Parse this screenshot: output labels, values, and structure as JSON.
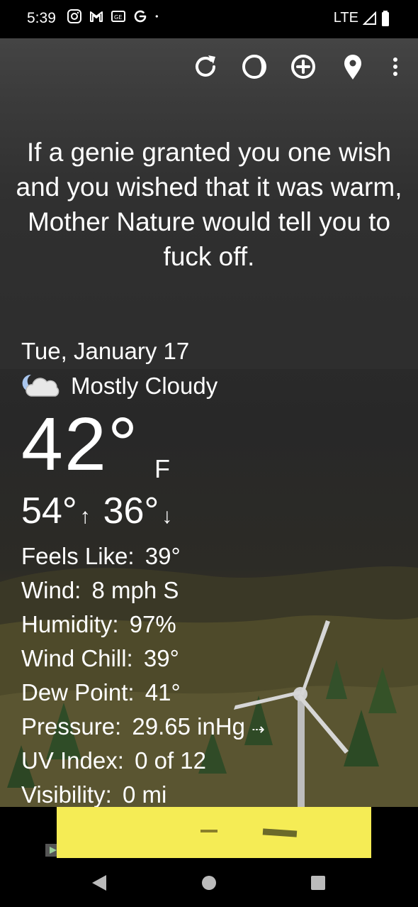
{
  "status_bar": {
    "time": "5:39",
    "network": "LTE",
    "notification_icons": [
      "instagram-icon",
      "gmail-icon",
      "news-icon",
      "google-icon",
      "dot-icon"
    ]
  },
  "toolbar": {
    "icons": [
      "refresh-icon",
      "theme-icon",
      "add-location-icon",
      "location-pin-icon",
      "more-options-icon"
    ]
  },
  "quote": "If a genie granted you one wish and you wished that it was warm, Mother Nature would tell you to fuck off.",
  "weather": {
    "date": "Tue, January 17",
    "condition": "Mostly Cloudy",
    "condition_icon": "moon-cloud-icon",
    "temperature": "42",
    "degree_symbol": "°",
    "unit": "F",
    "high": "54°",
    "high_arrow": "↑",
    "low": "36°",
    "low_arrow": "↓"
  },
  "details": {
    "feels_like_label": "Feels Like:",
    "feels_like_value": "39°",
    "wind_label": "Wind:",
    "wind_value": "8 mph S",
    "humidity_label": "Humidity:",
    "humidity_value": "97%",
    "wind_chill_label": "Wind Chill:",
    "wind_chill_value": "39°",
    "dew_point_label": "Dew Point:",
    "dew_point_value": "41°",
    "pressure_label": "Pressure:",
    "pressure_value": "29.65 inHg",
    "pressure_trend": "⇢",
    "uv_label": "UV Index:",
    "uv_value": "0 of 12",
    "visibility_label": "Visibility:",
    "visibility_value": "0 mi"
  },
  "colors": {
    "ad_banner": "#f5ec55",
    "text": "#ffffff"
  }
}
